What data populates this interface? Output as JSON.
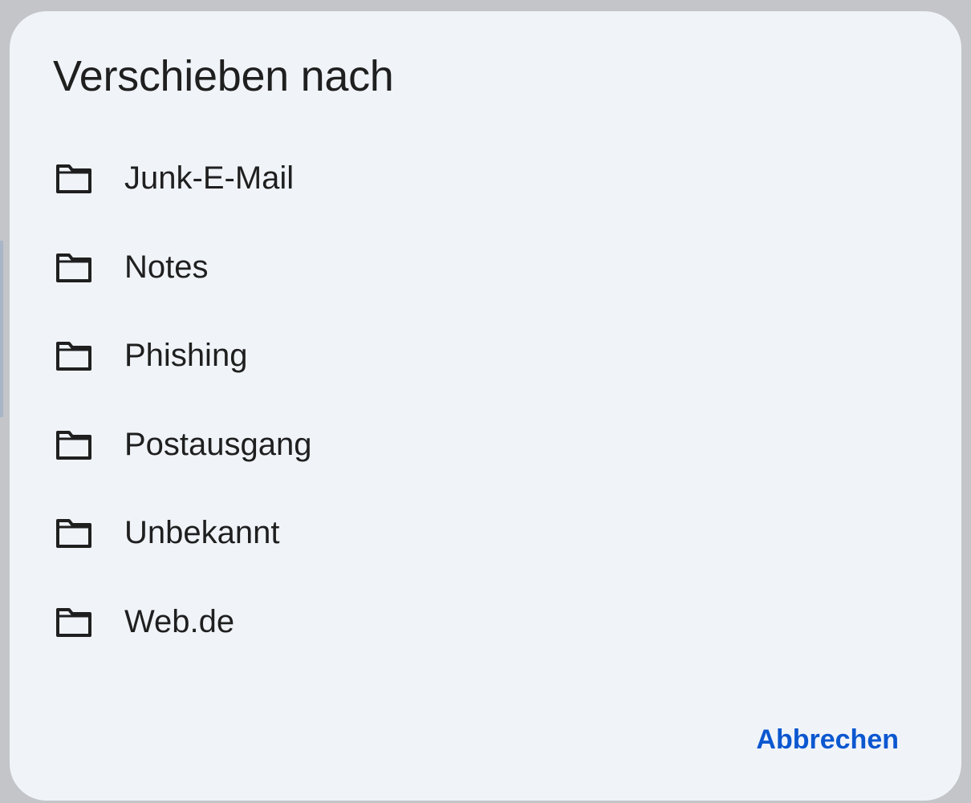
{
  "dialog": {
    "title": "Verschieben nach",
    "folders": [
      {
        "label": "Junk-E-Mail",
        "icon": "folder-icon"
      },
      {
        "label": "Notes",
        "icon": "folder-icon"
      },
      {
        "label": "Phishing",
        "icon": "folder-icon"
      },
      {
        "label": "Postausgang",
        "icon": "folder-icon"
      },
      {
        "label": "Unbekannt",
        "icon": "folder-icon"
      },
      {
        "label": "Web.de",
        "icon": "folder-icon"
      }
    ],
    "cancel_label": "Abbrechen"
  },
  "colors": {
    "dialog_background": "#f0f4f9",
    "text": "#1f1f1f",
    "accent": "#0b57d0",
    "backdrop": "#c3c5c8"
  }
}
